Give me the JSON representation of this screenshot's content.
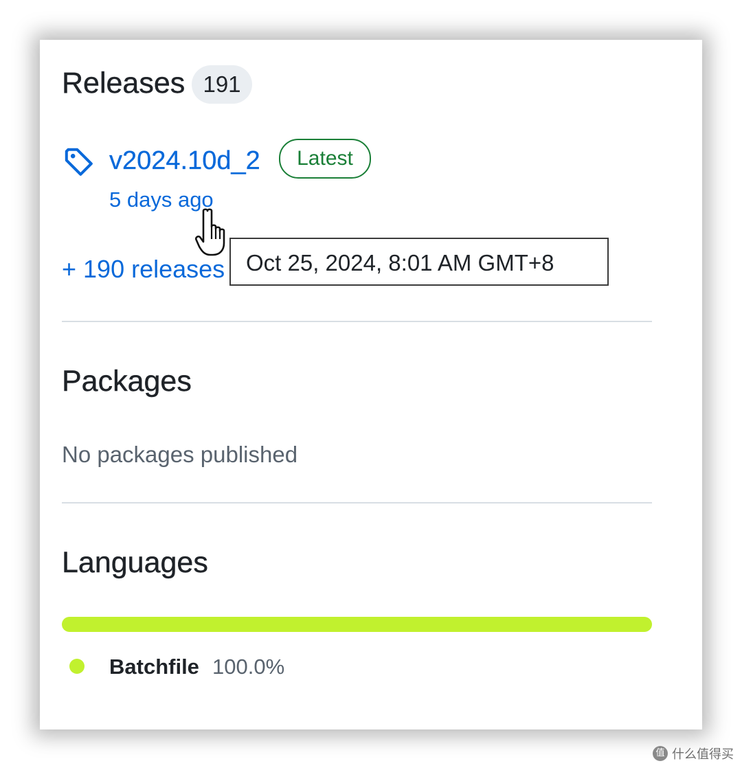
{
  "releases": {
    "title": "Releases",
    "count": "191",
    "latest": {
      "name": "v2024.10d_2",
      "badge": "Latest",
      "time": "5 days ago",
      "tooltip": "Oct 25, 2024, 8:01 AM GMT+8"
    },
    "more_link": "+ 190 releases"
  },
  "packages": {
    "title": "Packages",
    "empty_text": "No packages published"
  },
  "languages": {
    "title": "Languages",
    "items": [
      {
        "name": "Batchfile",
        "percent": "100.0%",
        "share": 1.0,
        "color": "#C1F12E"
      }
    ]
  },
  "watermark": {
    "logo_glyph": "值",
    "text": "什么值得买"
  }
}
